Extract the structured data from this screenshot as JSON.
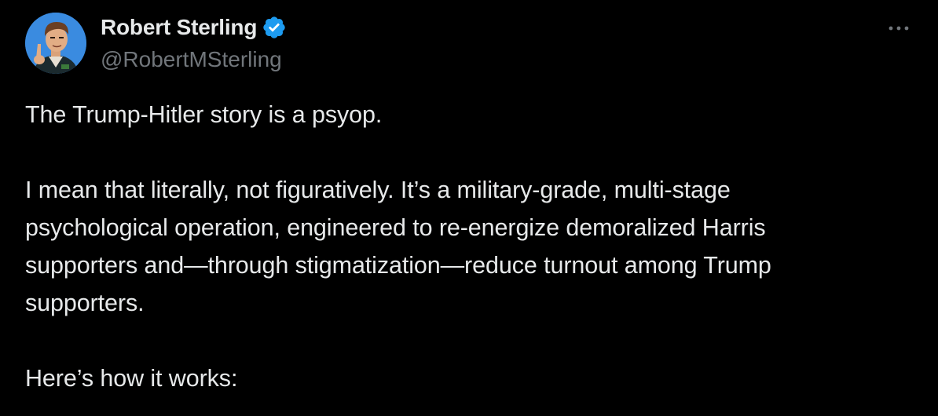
{
  "tweet": {
    "author": {
      "display_name": "Robert Sterling",
      "handle": "@RobertMSterling",
      "verified": true,
      "avatar": "cartoon-man-avatar-icon"
    },
    "more_icon": "more-dots-icon",
    "paragraphs": [
      {
        "lines": [
          "The Trump-Hitler story is a psyop."
        ]
      },
      {
        "lines": [
          "I mean that literally, not figuratively. It’s a military-grade, multi-stage",
          "psychological operation, engineered to re-energize demoralized Harris",
          "supporters and—through stigmatization—reduce turnout among Trump",
          "supporters."
        ]
      },
      {
        "lines": [
          "Here’s how it works:"
        ]
      }
    ]
  },
  "colors": {
    "background": "#000000",
    "text_primary": "#e7e9ea",
    "text_secondary": "#71767b",
    "verified_badge": "#1d9bf0"
  }
}
